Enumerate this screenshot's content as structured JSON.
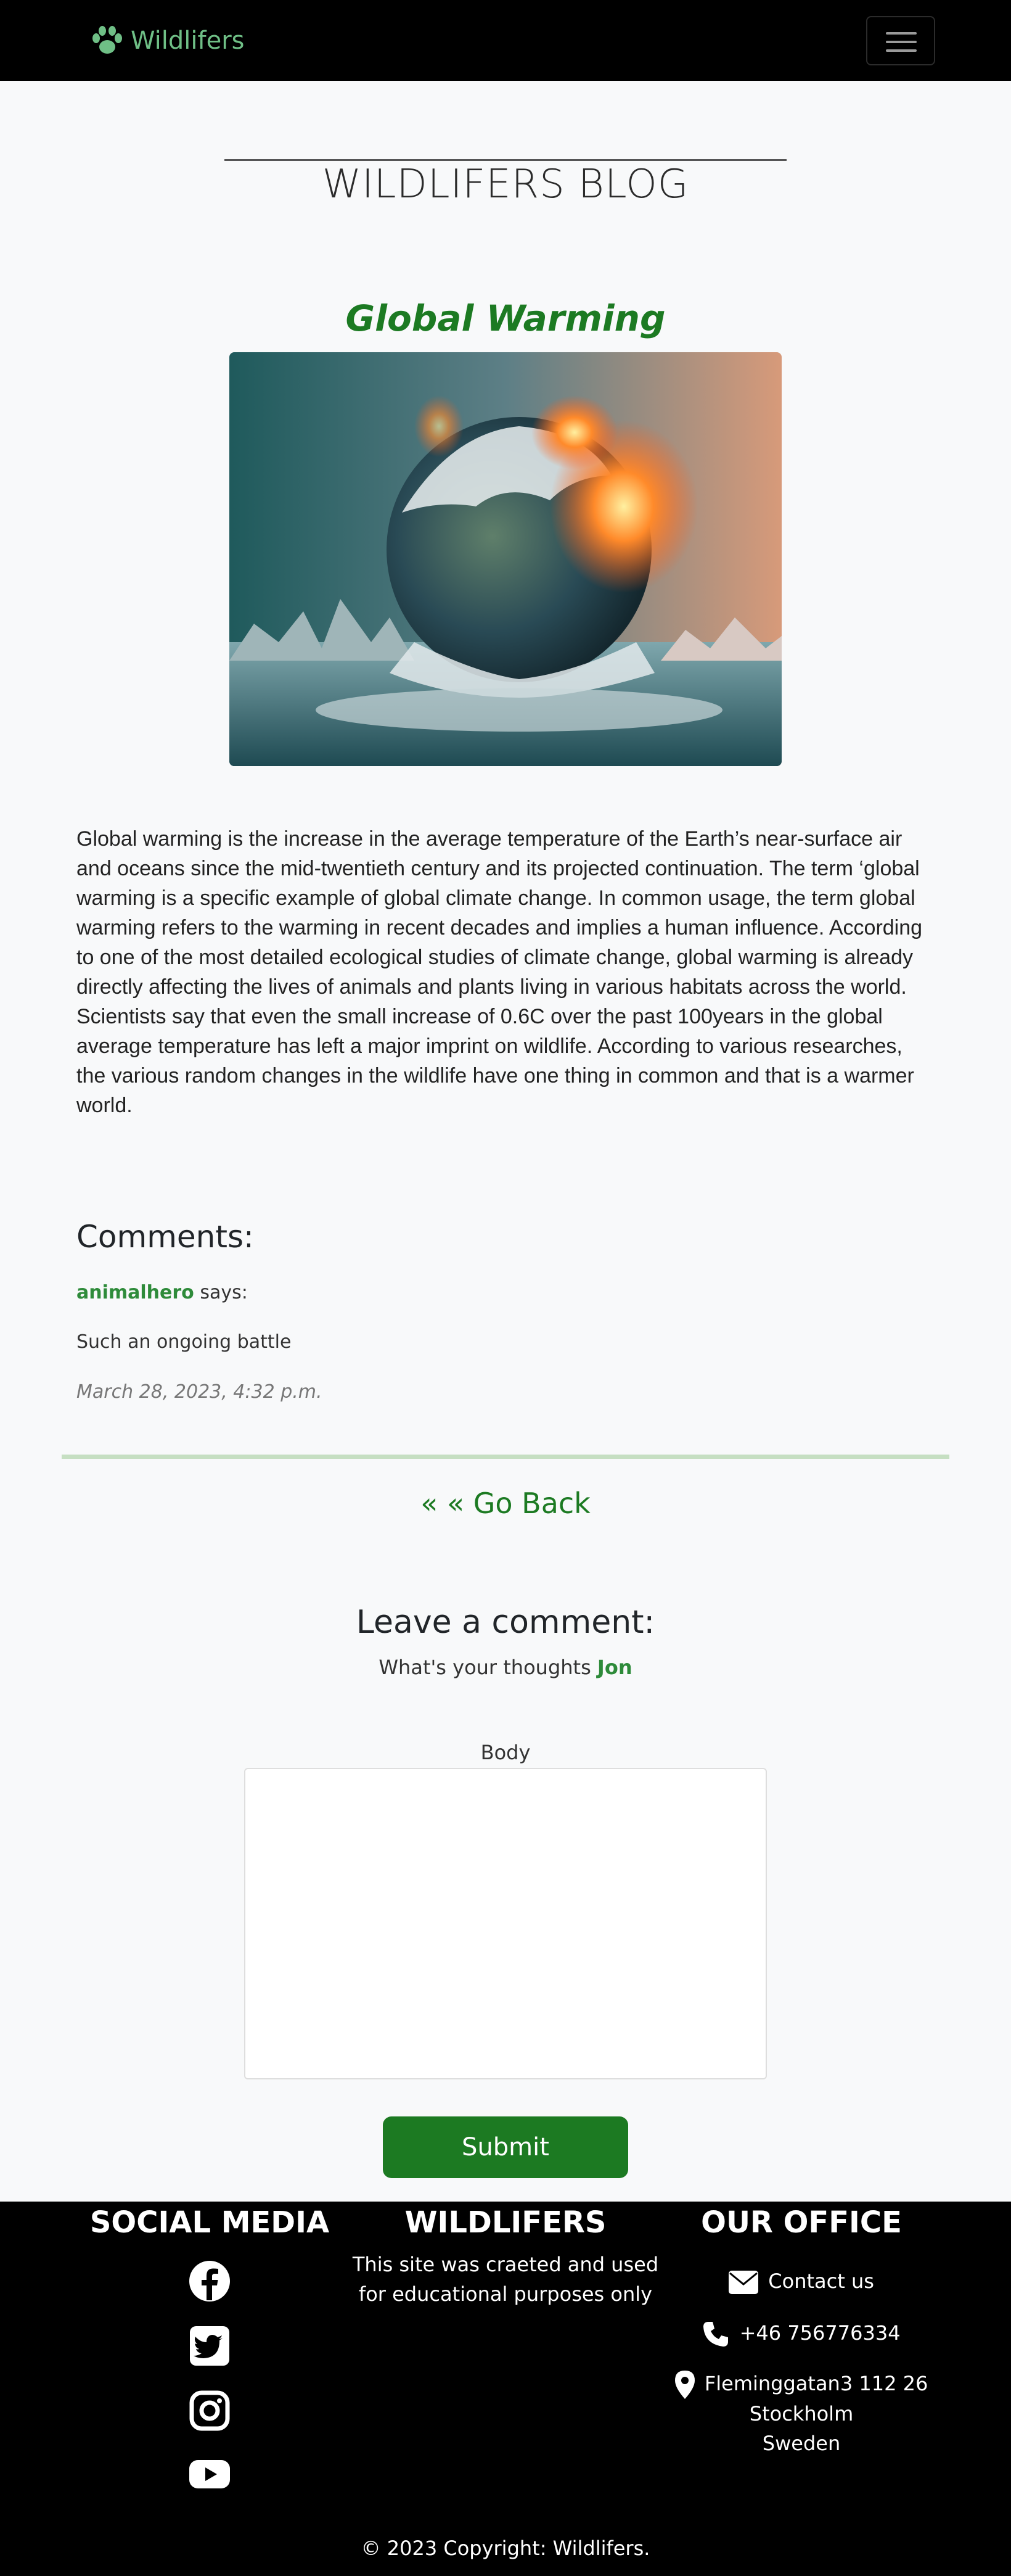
{
  "navbar": {
    "brand": "Wildlifers",
    "brand_icon": "paw-icon",
    "toggler_icon": "hamburger-menu-icon",
    "brand_color": "#6fbf86"
  },
  "blog": {
    "title": "WILDLIFERS BLOG"
  },
  "post": {
    "title": "Global Warming",
    "image_alt": "melting-earth-image",
    "body": "Global warming is the increase in the average temperature of the Earth’s near-surface air and oceans since the mid-twentieth century and its projected continuation. The term ‘global warming is a specific example of global climate change. In common usage, the term global warming refers to the warming in recent decades and implies a human influence. According to one of the most detailed ecological studies of climate change, global warming is already directly affecting the lives of animals and plants living in various habitats across the world. Scientists say that even the small increase of 0.6C over the past 100years in the global average temperature has left a major imprint on wildlife. According to various researches, the various random changes in the wildlife have one thing in common and that is a warmer world."
  },
  "comments": {
    "heading": "Comments:",
    "items": [
      {
        "author": "animalhero",
        "says": "says:",
        "text": "Such an ongoing battle",
        "date": "March 28, 2023, 4:32 p.m."
      }
    ]
  },
  "go_back": "« « Go Back",
  "leave_comment": {
    "heading": "Leave a comment:",
    "prompt": "What's your thoughts",
    "user": "Jon",
    "body_label": "Body",
    "body_value": "",
    "submit_label": "Submit"
  },
  "footer": {
    "social_heading": "SOCIAL MEDIA",
    "social_icons": [
      "facebook-icon",
      "twitter-icon",
      "instagram-icon",
      "youtube-icon"
    ],
    "about_heading": "WILDLIFERS",
    "about_line1": "This site was craeted and used",
    "about_line2": "for educational purposes only",
    "office_heading": "OUR OFFICE",
    "contact_label": "Contact us",
    "phone": "+46 756776334",
    "address_line1": "Fleminggatan3 112 26",
    "address_line2": "Stockholm",
    "address_line3": "Sweden",
    "copyright": "© 2023 Copyright: Wildlifers."
  },
  "colors": {
    "accent_green": "#1c7a22",
    "link_green": "#2e8b3a",
    "footer_bg": "#000000"
  }
}
